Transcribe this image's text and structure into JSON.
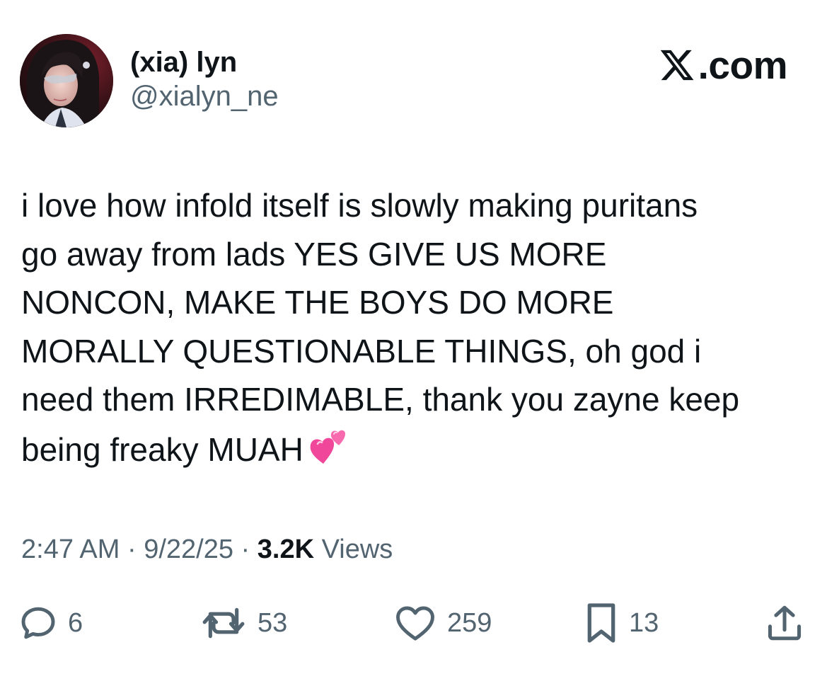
{
  "author": {
    "display_name": "(xia) lyn",
    "handle": "@xialyn_ne",
    "avatar_icon": "profile-avatar"
  },
  "brand": {
    "icon": "x-logo-icon",
    "text": ".com"
  },
  "tweet": {
    "lines": [
      "i love how infold itself is slowly making puritans",
      "go away from lads YES GIVE US MORE",
      "NONCON, MAKE THE BOYS DO MORE",
      "MORALLY QUESTIONABLE THINGS, oh god i",
      "need them IRREDIMABLE, thank you zayne keep",
      "being freaky MUAH"
    ],
    "emoji": "two-hearts-emoji"
  },
  "meta": {
    "time": "2:47 AM",
    "sep1": " · ",
    "date": "9/22/25",
    "sep2": " · ",
    "views_count": "3.2K",
    "views_label": " Views"
  },
  "actions": {
    "replies": "6",
    "reposts": "53",
    "likes": "259",
    "bookmarks": "13"
  },
  "colors": {
    "text": "#0f1419",
    "secondary": "#536471",
    "emoji_pink": "#f0479a"
  }
}
